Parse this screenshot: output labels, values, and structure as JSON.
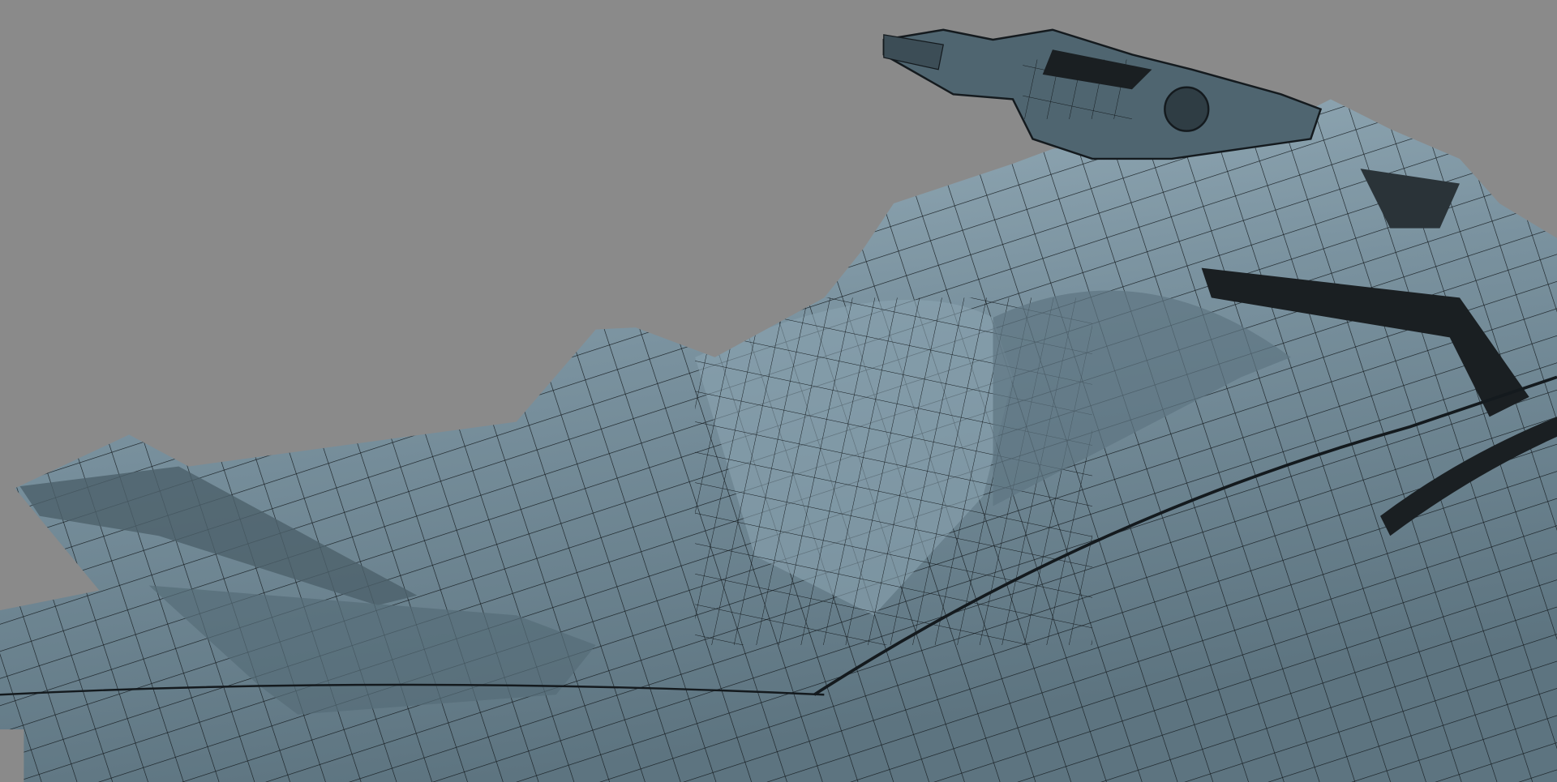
{
  "scene": {
    "background_color": "#8a8a8a",
    "surface_color": "#6f8794",
    "highlight_color": "#9fb6c2",
    "shadow_color": "#3f4f58",
    "wire_color": "#141a1e",
    "render_style": "shaded-wireframe"
  }
}
